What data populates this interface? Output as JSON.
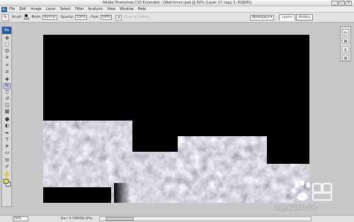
{
  "window": {
    "title": "Adobe Photoshop CS3 Extended - [Watchmen.psd @ 50% (Layer 17 copy 3, RGB/8)]",
    "controls": [
      "_",
      "□",
      "×"
    ]
  },
  "menu": {
    "app_icon": "Ps",
    "items": [
      "File",
      "Edit",
      "Image",
      "Layer",
      "Select",
      "Filter",
      "Analysis",
      "View",
      "Window",
      "Help"
    ]
  },
  "options": {
    "tool_icon": "brush-icon",
    "tool_glyph": "✎",
    "brush_label": "Brush:",
    "brush_size": "100",
    "mode_label": "Mode:",
    "mode_value": "Normal",
    "opacity_label": "Opacity:",
    "opacity_value": "100%",
    "flow_label": "Flow:",
    "flow_value": "100%",
    "airbrush_glyph": "✈",
    "grayed_option": "Erase to History",
    "workspace_label": "Workspace ▾",
    "palette_tabs": [
      "Layers",
      "History"
    ]
  },
  "toolbox": {
    "logo": "Ps",
    "tools": [
      {
        "name": "move-tool-icon",
        "glyph": "✥"
      },
      {
        "name": "marquee-tool-icon",
        "glyph": "⬚"
      },
      {
        "name": "lasso-tool-icon",
        "glyph": "ʘ"
      },
      {
        "name": "magic-wand-tool-icon",
        "glyph": "✳"
      },
      {
        "name": "crop-tool-icon",
        "glyph": "⌗"
      },
      {
        "name": "slice-tool-icon",
        "glyph": "⧄"
      },
      {
        "name": "healing-brush-tool-icon",
        "glyph": "✚"
      },
      {
        "name": "brush-tool-icon",
        "glyph": "✎"
      },
      {
        "name": "clone-stamp-tool-icon",
        "glyph": "♖"
      },
      {
        "name": "history-brush-tool-icon",
        "glyph": "↺"
      },
      {
        "name": "eraser-tool-icon",
        "glyph": "◫"
      },
      {
        "name": "gradient-tool-icon",
        "glyph": "▦"
      },
      {
        "name": "blur-tool-icon",
        "glyph": "●"
      },
      {
        "name": "dodge-tool-icon",
        "glyph": "◐"
      },
      {
        "name": "pen-tool-icon",
        "glyph": "✒"
      },
      {
        "name": "type-tool-icon",
        "glyph": "T"
      },
      {
        "name": "path-selection-tool-icon",
        "glyph": "➤"
      },
      {
        "name": "shape-tool-icon",
        "glyph": "▭"
      },
      {
        "name": "notes-tool-icon",
        "glyph": "✉"
      },
      {
        "name": "eyedropper-tool-icon",
        "glyph": "✐"
      },
      {
        "name": "hand-tool-icon",
        "glyph": "✋"
      },
      {
        "name": "zoom-tool-icon",
        "glyph": "⚲"
      }
    ],
    "foreground_color": "#f4ea22",
    "background_color": "#ffffff"
  },
  "dock": {
    "icons": [
      {
        "name": "tools-palette-icon",
        "glyph": "✂"
      },
      {
        "name": "navigator-palette-icon",
        "glyph": "⊞"
      },
      {
        "name": "info-palette-icon",
        "glyph": "ℹ"
      },
      {
        "name": "layers-palette-icon",
        "glyph": "≣"
      }
    ]
  },
  "status": {
    "zoom": "50%",
    "doc_info": "Doc: 6.59M/68.5M",
    "arrow": "▸"
  },
  "watermark": {
    "url": "jingyan.baidu.com",
    "logo": "baidu-paw-logo"
  },
  "colors": {
    "canvas_background": "#000000",
    "texture_base": "#8d9096",
    "selection_highlight": "#b9c7dd"
  }
}
